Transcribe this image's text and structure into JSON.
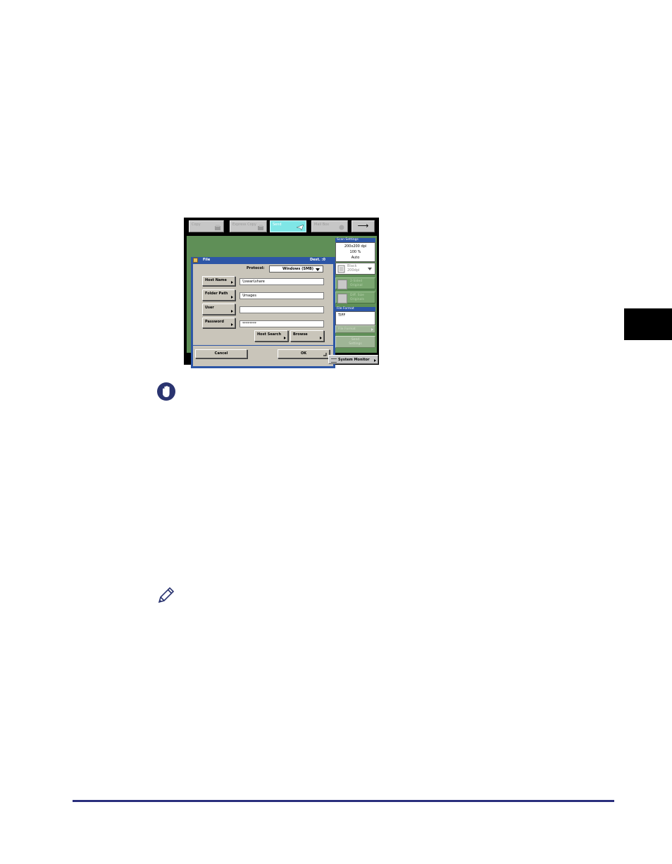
{
  "screen": {
    "tabs": [
      {
        "label": "Copy",
        "active": false
      },
      {
        "label": "Express Copy",
        "active": false
      },
      {
        "label": "Send",
        "active": true
      },
      {
        "label": "Mail Box",
        "active": false
      }
    ],
    "next_arrow": "⟶",
    "dialog": {
      "title": "File",
      "dest_label": "Dest. :0",
      "protocol_label": "Protocol:",
      "protocol_value": "Windows (SMB)",
      "host_name_button": "Host Name",
      "host_name_value": "\\\\swan\\share",
      "folder_path_button": "Folder Path",
      "folder_path_value": "\\Images",
      "user_button": "User",
      "user_value": "",
      "password_button": "Password",
      "password_value": "********",
      "host_search_button": "Host Search",
      "browse_button": "Browse",
      "cancel_button": "Cancel",
      "ok_button": "OK"
    },
    "side_panel": {
      "scan_settings_label": "Scan Settings",
      "resolution": "200x200 dpi",
      "zoom": "100 %",
      "density": "Auto",
      "color_mode_line1": "Black",
      "color_mode_line2": "200dpi",
      "two_sided_line1": "2-Sided",
      "two_sided_line2": "Original",
      "diff_size_line1": "Diff. Size",
      "diff_size_line2": "Originals",
      "file_format_label": "File Format",
      "file_format_value": "TIFF",
      "file_format_button": "File Format",
      "send_settings_line1": "Send",
      "send_settings_line2": "Settings"
    },
    "system_monitor_button": "System Monitor"
  },
  "colors": {
    "accent_blue": "#2d56a6",
    "screen_green": "#5f8f57",
    "active_tab": "#7fe6e6",
    "footer_rule": "#2a2f7c"
  }
}
